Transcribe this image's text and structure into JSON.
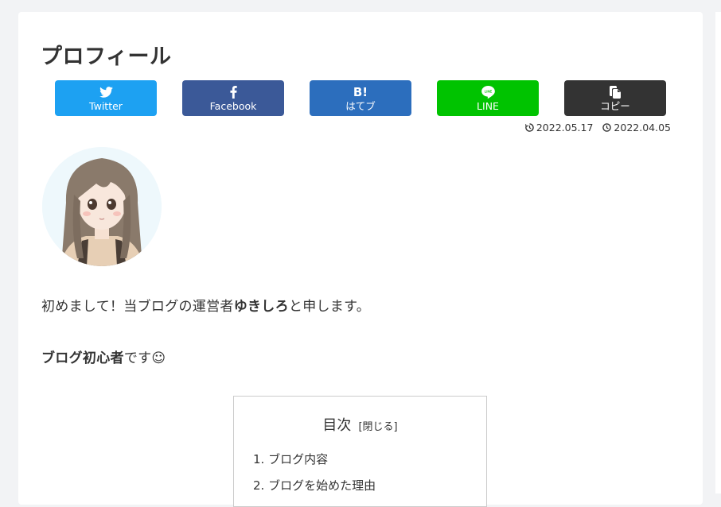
{
  "page": {
    "title": "プロフィール"
  },
  "share": {
    "buttons": [
      {
        "label": "Twitter",
        "icon": "twitter-icon",
        "color": "#1da1f2"
      },
      {
        "label": "Facebook",
        "icon": "facebook-icon",
        "color": "#3b5998"
      },
      {
        "label": "はてブ",
        "icon": "hatena-bookmark-icon",
        "icon_text": "B!",
        "color": "#2c6ebd"
      },
      {
        "label": "LINE",
        "icon": "line-icon",
        "color": "#00c300"
      },
      {
        "label": "コピー",
        "icon": "copy-icon",
        "color": "#333333"
      }
    ]
  },
  "dates": {
    "updated": "2022.05.17",
    "published": "2022.04.05"
  },
  "content": {
    "p1_before": "初めまして！当ブログの運営者",
    "p1_bold": "ゆきしろ",
    "p1_after": "と申します。",
    "p2_bold": "ブログ初心者",
    "p2_after": "です☺"
  },
  "toc": {
    "title": "目次",
    "toggle": "[閉じる]",
    "items": [
      {
        "num": "1.",
        "label": "ブログ内容"
      },
      {
        "num": "2.",
        "label": "ブログを始めた理由"
      }
    ]
  }
}
